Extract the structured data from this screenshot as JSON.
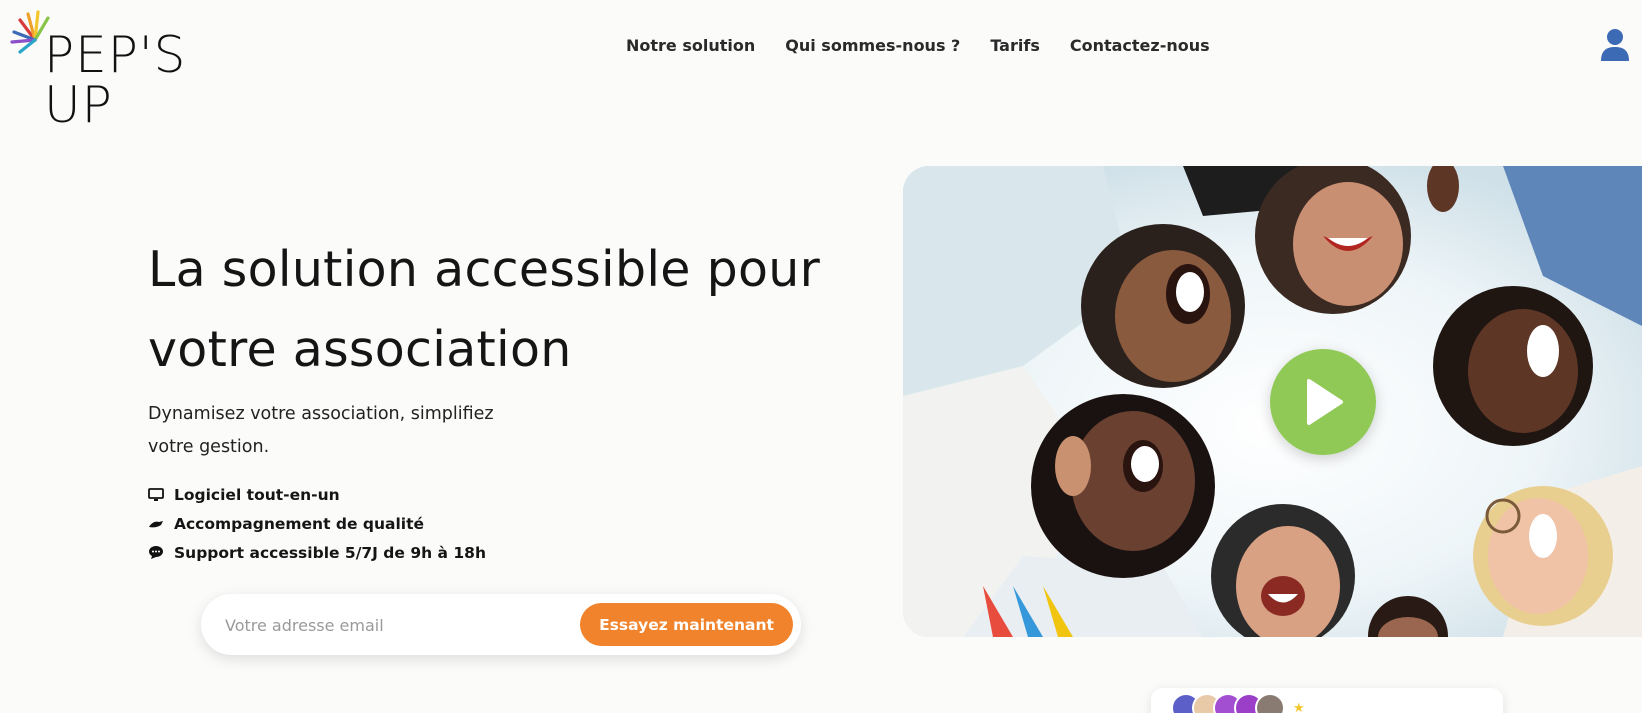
{
  "brand": {
    "name": "PEP'S UP",
    "accent": "#f0832b",
    "play_color": "#88c449",
    "icon_color": "#3d6ab4"
  },
  "nav": {
    "items": [
      {
        "label": "Notre solution"
      },
      {
        "label": "Qui sommes-nous ?"
      },
      {
        "label": "Tarifs"
      },
      {
        "label": "Contactez-nous"
      }
    ],
    "account_icon": "user-icon"
  },
  "hero": {
    "title": "La solution accessible pour votre association",
    "subtitle": "Dynamisez votre association, simplifiez votre gestion.",
    "features": [
      {
        "icon": "monitor-icon",
        "label": "Logiciel tout-en-un"
      },
      {
        "icon": "handshake-icon",
        "label": "Accompagnement de qualité"
      },
      {
        "icon": "chat-icon",
        "label": "Support accessible 5/7J de 9h à 18h"
      }
    ]
  },
  "signup": {
    "placeholder": "Votre adresse email",
    "button_label": "Essayez maintenant"
  },
  "video": {
    "play_icon": "play-icon"
  },
  "rating": {
    "avatar_colors": [
      "#5b5fc7",
      "#e8c9a8",
      "#a24fd1",
      "#9b3fc9",
      "#8a7b72"
    ]
  }
}
